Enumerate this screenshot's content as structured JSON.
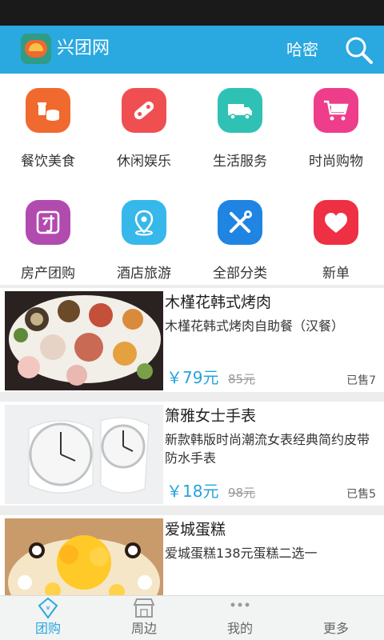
{
  "header": {
    "title": "兴团网",
    "city": "哈密"
  },
  "categories": [
    {
      "label": "餐饮美食",
      "icon": "food-icon",
      "color": "#f06a2f"
    },
    {
      "label": "休闲娱乐",
      "icon": "gamepad-icon",
      "color": "#f04f52"
    },
    {
      "label": "生活服务",
      "icon": "truck-icon",
      "color": "#2fc1b4"
    },
    {
      "label": "时尚购物",
      "icon": "cart-icon",
      "color": "#ee3d8a"
    },
    {
      "label": "房产团购",
      "icon": "tuan-icon",
      "color": "#b24bb0"
    },
    {
      "label": "酒店旅游",
      "icon": "location-icon",
      "color": "#36b8ea"
    },
    {
      "label": "全部分类",
      "icon": "tools-icon",
      "color": "#1f84e2"
    },
    {
      "label": "新单",
      "icon": "heart-icon",
      "color": "#ee2f44"
    }
  ],
  "deals": [
    {
      "title": "木槿花韩式烤肉",
      "desc": "木槿花韩式烤肉自助餐（汉餐）",
      "price": "￥79元",
      "orig": "85元",
      "sold": "已售7"
    },
    {
      "title": "箫雅女士手表",
      "desc": "新款韩版时尚潮流女表经典简约皮带防水手表",
      "price": "￥18元",
      "orig": "98元",
      "sold": "已售5"
    },
    {
      "title": "爱城蛋糕",
      "desc": "爱城蛋糕138元蛋糕二选一",
      "price": "",
      "orig": "",
      "sold": ""
    }
  ],
  "tabs": [
    {
      "label": "团购",
      "icon": "tuangou-tab-icon",
      "active": true
    },
    {
      "label": "周边",
      "icon": "store-icon",
      "active": false
    },
    {
      "label": "我的",
      "icon": "more-dots-icon",
      "active": false
    },
    {
      "label": "更多",
      "icon": "more-icon",
      "active": false
    }
  ],
  "colors": {
    "brand": "#2aa8e0",
    "price": "#25a3db"
  }
}
